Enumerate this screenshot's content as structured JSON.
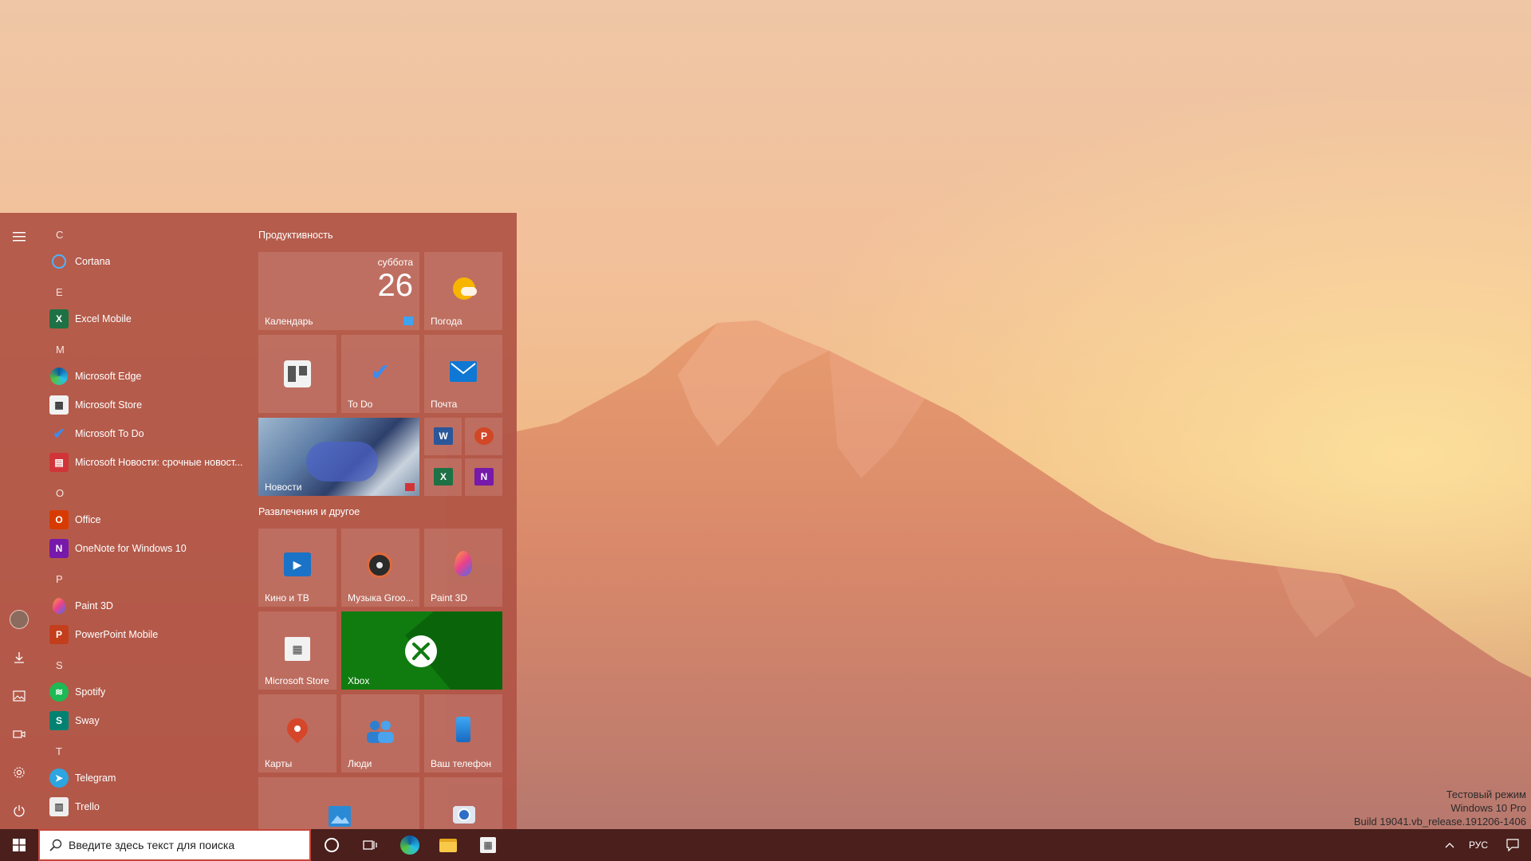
{
  "watermark": {
    "line1": "Тестовый режим",
    "line2": "Windows 10 Pro",
    "line3": "Build 19041.vb_release.191206-1406"
  },
  "start_menu": {
    "app_list": [
      {
        "type": "letter",
        "label": "C"
      },
      {
        "type": "app",
        "label": "Cortana",
        "icon": "cortana-icon"
      },
      {
        "type": "letter",
        "label": "E"
      },
      {
        "type": "app",
        "label": "Excel Mobile",
        "icon": "excel-icon"
      },
      {
        "type": "letter",
        "label": "M"
      },
      {
        "type": "app",
        "label": "Microsoft Edge",
        "icon": "edge-icon"
      },
      {
        "type": "app",
        "label": "Microsoft Store",
        "icon": "store-icon"
      },
      {
        "type": "app",
        "label": "Microsoft To Do",
        "icon": "todo-icon"
      },
      {
        "type": "app",
        "label": "Microsoft Новости: срочные новост...",
        "icon": "news-icon"
      },
      {
        "type": "letter",
        "label": "O"
      },
      {
        "type": "app",
        "label": "Office",
        "icon": "office-icon"
      },
      {
        "type": "app",
        "label": "OneNote for Windows 10",
        "icon": "onenote-icon"
      },
      {
        "type": "letter",
        "label": "P"
      },
      {
        "type": "app",
        "label": "Paint 3D",
        "icon": "paint3d-icon"
      },
      {
        "type": "app",
        "label": "PowerPoint Mobile",
        "icon": "powerpoint-icon"
      },
      {
        "type": "letter",
        "label": "S"
      },
      {
        "type": "app",
        "label": "Spotify",
        "icon": "spotify-icon"
      },
      {
        "type": "app",
        "label": "Sway",
        "icon": "sway-icon"
      },
      {
        "type": "letter",
        "label": "T"
      },
      {
        "type": "app",
        "label": "Telegram",
        "icon": "telegram-icon"
      },
      {
        "type": "app",
        "label": "Trello",
        "icon": "trello-icon"
      }
    ],
    "groups": {
      "productivity": "Продуктивность",
      "entertainment": "Развлечения и другое"
    },
    "tiles": {
      "calendar": {
        "label": "Календарь",
        "day_name": "суббота",
        "day_number": "26"
      },
      "weather": {
        "label": "Погода"
      },
      "todo": {
        "label": "To Do"
      },
      "mail": {
        "label": "Почта"
      },
      "news": {
        "label": "Новости"
      },
      "movies": {
        "label": "Кино и ТВ"
      },
      "groove": {
        "label": "Музыка Groo..."
      },
      "paint3d": {
        "label": "Paint 3D"
      },
      "store": {
        "label": "Microsoft Store"
      },
      "xbox": {
        "label": "Xbox"
      },
      "maps": {
        "label": "Карты"
      },
      "people": {
        "label": "Люди"
      },
      "phone": {
        "label": "Ваш телефон"
      }
    }
  },
  "taskbar": {
    "search_placeholder": "Введите здесь текст для поиска",
    "language": "РУС"
  },
  "colors": {
    "start_bg": "#b05446",
    "xbox_green": "#107c10",
    "taskbar_bg": "#4a1f1c"
  }
}
